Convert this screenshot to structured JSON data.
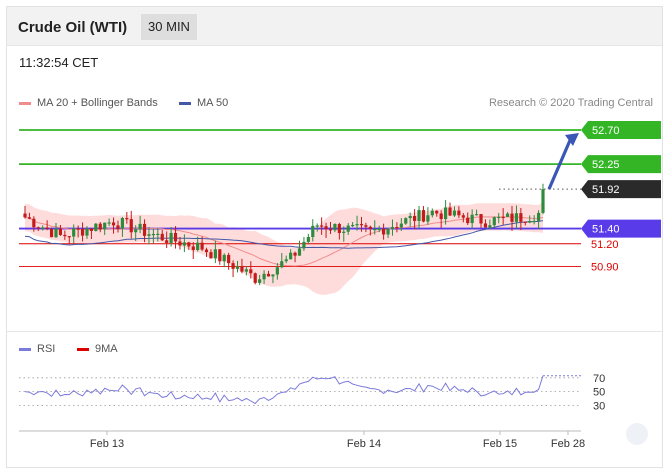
{
  "header": {
    "title": "Crude Oil (WTI)",
    "timeframe": "30 MIN"
  },
  "time": "11:32:54 CET",
  "legend": {
    "ma20_label": "MA 20 + Bollinger Bands",
    "ma50_label": "MA 50",
    "credit": "Research © 2020 Trading Central",
    "rsi_label": "RSI",
    "rsi_ma_label": "9MA"
  },
  "colors": {
    "green": "#33b526",
    "blue": "#5a3bea",
    "red": "#dd0000",
    "bull": "#2e8b3d",
    "bear": "#c31a1a",
    "band": "#ffd6d6",
    "ma20": "#f08c8c",
    "ma50": "#4458a8",
    "arrow": "#3a57b8",
    "dark": "#2a2a2a"
  },
  "chart_data": {
    "type": "candlestick",
    "instrument": "Crude Oil (WTI)",
    "timeframe": "30 MIN",
    "x_ticks": [
      "Feb 13",
      "Feb 14",
      "Feb 15",
      "Feb 28"
    ],
    "y_range": [
      50.05,
      52.95
    ],
    "levels": [
      {
        "value": 52.7,
        "label": "52.70",
        "style": "resistance"
      },
      {
        "value": 52.25,
        "label": "52.25",
        "style": "resistance"
      },
      {
        "value": 51.92,
        "label": "51.92",
        "style": "last"
      },
      {
        "value": 51.4,
        "label": "51.40",
        "style": "pivot"
      },
      {
        "value": 51.2,
        "label": "51.20",
        "style": "support"
      },
      {
        "value": 50.9,
        "label": "50.90",
        "style": "support"
      }
    ],
    "projection": {
      "from": 51.92,
      "to": 52.7
    },
    "rsi": {
      "levels": [
        70,
        50,
        30
      ],
      "tick_labels": [
        "70",
        "50",
        "30"
      ],
      "range": [
        0,
        100
      ]
    }
  }
}
